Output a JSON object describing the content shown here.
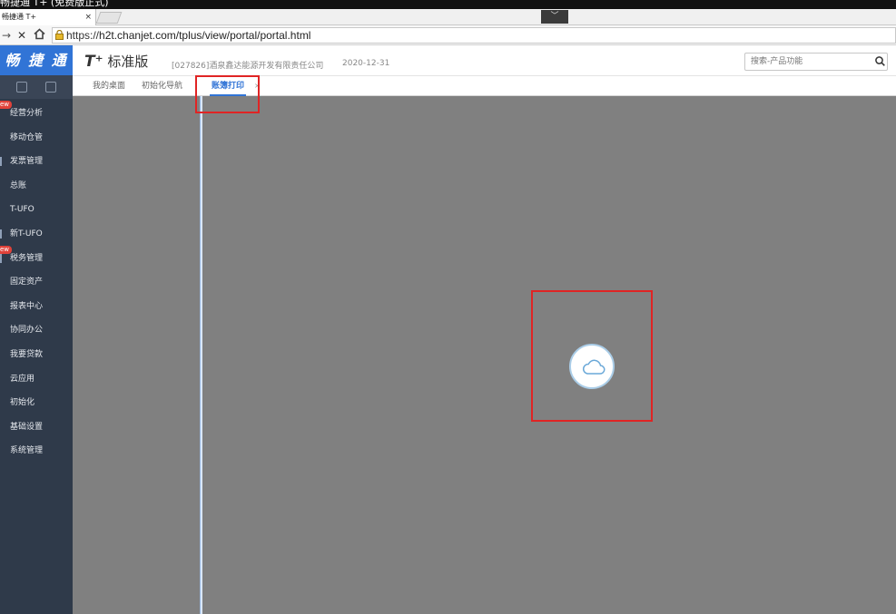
{
  "window": {
    "title": "畅捷通 T+ (免费版正式)"
  },
  "browser": {
    "tab_label": "畅捷通 T+",
    "tab_close": "×",
    "dropdown": "﹀",
    "url_scheme": "https://",
    "url_rest": "h2t.chanjet.com/tplus/view/portal/portal.html"
  },
  "sidebar": {
    "logo": "畅 捷 通",
    "new_badge": "ew",
    "items": [
      {
        "label": "经营分析"
      },
      {
        "label": "移动仓管"
      },
      {
        "label": "发票管理"
      },
      {
        "label": "总账"
      },
      {
        "label": "T-UFO"
      },
      {
        "label": "新T-UFO"
      },
      {
        "label": "税务管理"
      },
      {
        "label": "固定资产"
      },
      {
        "label": "报表中心"
      },
      {
        "label": "协同办公"
      },
      {
        "label": "我要贷款"
      },
      {
        "label": "云应用"
      },
      {
        "label": "初始化"
      },
      {
        "label": "基础设置"
      },
      {
        "label": "系统管理"
      }
    ]
  },
  "header": {
    "product_mark": "T⁺",
    "product_name": "标准版",
    "company": "[027826]酒泉鑫达能源开发有限责任公司",
    "date": "2020-12-31",
    "search_placeholder": "搜索-产品功能"
  },
  "tabs": [
    {
      "label": "我的桌面"
    },
    {
      "label": "初始化导航"
    },
    {
      "label": "账簿打印"
    }
  ],
  "tab_close": "×",
  "colors": {
    "accent": "#3174d6",
    "sidebar": "#2f3a4a",
    "overlay": "#808080",
    "highlight": "#e02424"
  }
}
